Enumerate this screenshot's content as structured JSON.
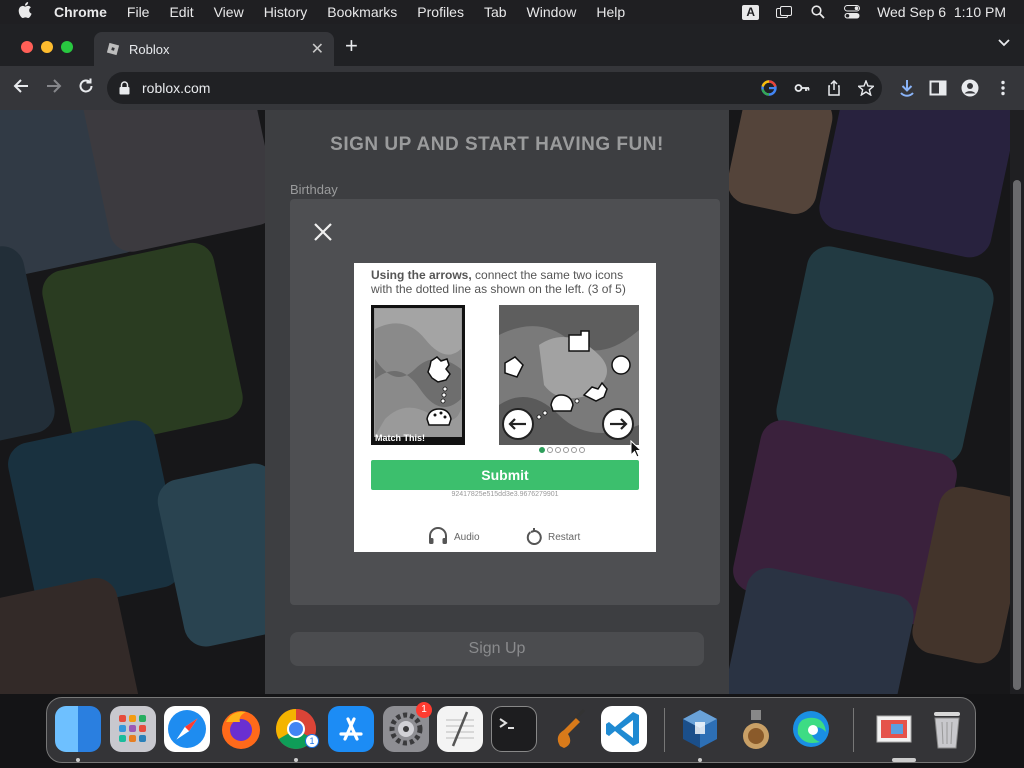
{
  "menubar": {
    "app_name": "Chrome",
    "menus": [
      "File",
      "Edit",
      "View",
      "History",
      "Bookmarks",
      "Profiles",
      "Tab",
      "Window",
      "Help"
    ],
    "input_indicator": "A",
    "clock": "Wed Sep 6  1:10 PM"
  },
  "browser": {
    "tab_title": "Roblox",
    "url": "roblox.com"
  },
  "signup": {
    "heading": "SIGN UP AND START HAVING FUN!",
    "birthday_label": "Birthday",
    "signup_button": "Sign Up"
  },
  "captcha": {
    "instruction_bold": "Using the arrows,",
    "instruction_rest": " connect the same two icons with the dotted line as shown on the left. (3 of 5)",
    "match_label": "Match This!",
    "submit_label": "Submit",
    "session_id": "92417825e515dd3e3.9676279901",
    "audio_label": "Audio",
    "restart_label": "Restart",
    "pagination": {
      "total": 6,
      "current": 1
    }
  },
  "dock": {
    "apps": [
      "Finder",
      "Launchpad",
      "Safari",
      "Firefox",
      "Chrome",
      "App Store",
      "System Settings",
      "TextEdit",
      "Terminal",
      "GarageBand",
      "Visual Studio Code",
      "VirtualBox",
      "Preview",
      "Edge",
      "Photos",
      "Trash"
    ],
    "settings_badge": "1",
    "chrome_badge": "1"
  },
  "colors": {
    "submit_green": "#3cbf6d",
    "active_dot": "#2e9e5b",
    "close_red": "#ff5f57",
    "minimize_yellow": "#febc2e",
    "maximize_green": "#28c840"
  }
}
